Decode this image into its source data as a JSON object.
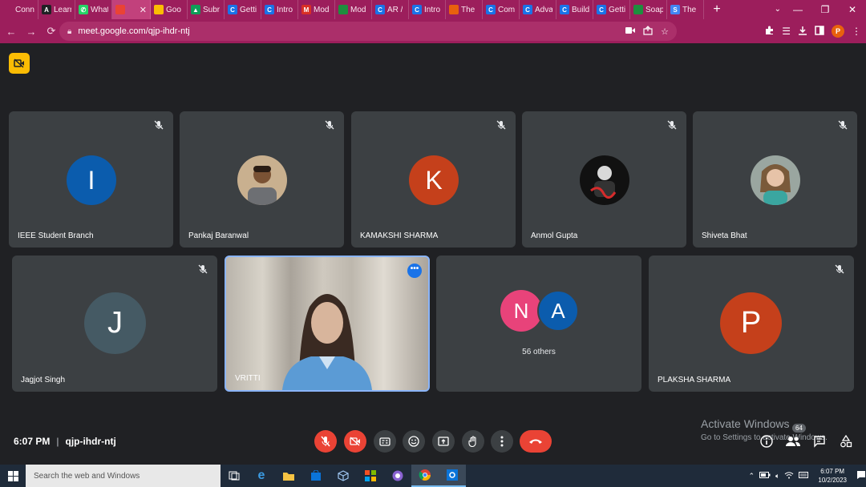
{
  "browser": {
    "tabs": [
      {
        "label": "Connect",
        "favicon_color": "#9c1e5c",
        "glyph": ""
      },
      {
        "label": "Learn",
        "favicon_color": "#202124",
        "glyph": "A"
      },
      {
        "label": "What",
        "favicon_color": "#25d366",
        "glyph": "✆"
      },
      {
        "label": "",
        "favicon_color": "#ea4335",
        "glyph": "",
        "active": true,
        "close": "✕"
      },
      {
        "label": "Goo",
        "favicon_color": "#fbbc04",
        "glyph": ""
      },
      {
        "label": "Subr",
        "favicon_color": "#0f9d58",
        "glyph": "▲"
      },
      {
        "label": "Getti",
        "favicon_color": "#1a73e8",
        "glyph": "C"
      },
      {
        "label": "Intro",
        "favicon_color": "#1a73e8",
        "glyph": "C"
      },
      {
        "label": "Mod",
        "favicon_color": "#d93025",
        "glyph": "M"
      },
      {
        "label": "Mod",
        "favicon_color": "#1e8e3e",
        "glyph": ""
      },
      {
        "label": "AR /",
        "favicon_color": "#1a73e8",
        "glyph": "C"
      },
      {
        "label": "Intro",
        "favicon_color": "#1a73e8",
        "glyph": "C"
      },
      {
        "label": "The",
        "favicon_color": "#e8610d",
        "glyph": ""
      },
      {
        "label": "Com",
        "favicon_color": "#1a73e8",
        "glyph": "C"
      },
      {
        "label": "Adva",
        "favicon_color": "#1a73e8",
        "glyph": "C"
      },
      {
        "label": "Build",
        "favicon_color": "#1a73e8",
        "glyph": "C"
      },
      {
        "label": "Getti",
        "favicon_color": "#1a73e8",
        "glyph": "C"
      },
      {
        "label": "Soap",
        "favicon_color": "#1e8e3e",
        "glyph": ""
      },
      {
        "label": "The",
        "favicon_color": "#4285f4",
        "glyph": "S"
      }
    ],
    "new_tab": "+",
    "url": "meet.google.com/qjp-ihdr-ntj",
    "profile_initial": "P"
  },
  "participants": [
    {
      "name": "IEEE Student Branch",
      "initial": "I",
      "avatar_color": "#0b5cad",
      "muted": true
    },
    {
      "name": "Pankaj Baranwal",
      "initial": "",
      "photo": true,
      "muted": true
    },
    {
      "name": "KAMAKSHI SHARMA",
      "initial": "K",
      "avatar_color": "#c5401b",
      "muted": true
    },
    {
      "name": "Anmol Gupta",
      "initial": "",
      "photo": true,
      "muted": true
    },
    {
      "name": "Shiveta Bhat",
      "initial": "",
      "photo": true,
      "muted": true
    },
    {
      "name": "Jagjot Singh",
      "initial": "J",
      "avatar_color": "#455a64",
      "muted": true
    },
    {
      "name": "VRITTI",
      "video": true,
      "muted": false
    },
    {
      "name": "56 others",
      "initials": [
        "N",
        "A"
      ],
      "avatar_colors": [
        "#e8437a",
        "#0b5cad"
      ]
    },
    {
      "name": "PLAKSHA SHARMA",
      "initial": "P",
      "avatar_color": "#c5401b",
      "muted": true
    }
  ],
  "meeting": {
    "time": "6:07 PM",
    "separator": "|",
    "code": "qjp-ihdr-ntj",
    "participant_count": "64"
  },
  "watermark": {
    "title": "Activate Windows",
    "subtitle": "Go to Settings to activate Windows."
  },
  "taskbar": {
    "search_placeholder": "Search the web and Windows",
    "time": "6:07 PM",
    "date": "10/2/2023"
  }
}
